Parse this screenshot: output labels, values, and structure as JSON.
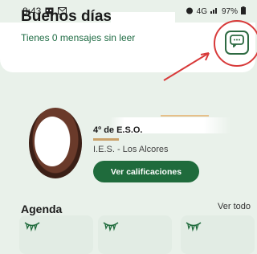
{
  "status_bar": {
    "time": "8:43",
    "battery": "97%",
    "signal_text": "4G"
  },
  "header": {
    "greeting": "Buenos días,",
    "subtitle": "Tienes 0 mensajes sin leer",
    "chat_button_icon": "chat-bubble-icon"
  },
  "student": {
    "grade": "4º de E.S.O.",
    "school": "I.E.S. - Los Alcores",
    "view_grades_label": "Ver calificaciones"
  },
  "agenda": {
    "title": "Agenda",
    "see_all_label": "Ver todo",
    "tile_icon": "garland-icon"
  },
  "colors": {
    "accent": "#1f6b3c",
    "annotation": "#d83a3a",
    "background": "#e9f1ea"
  }
}
